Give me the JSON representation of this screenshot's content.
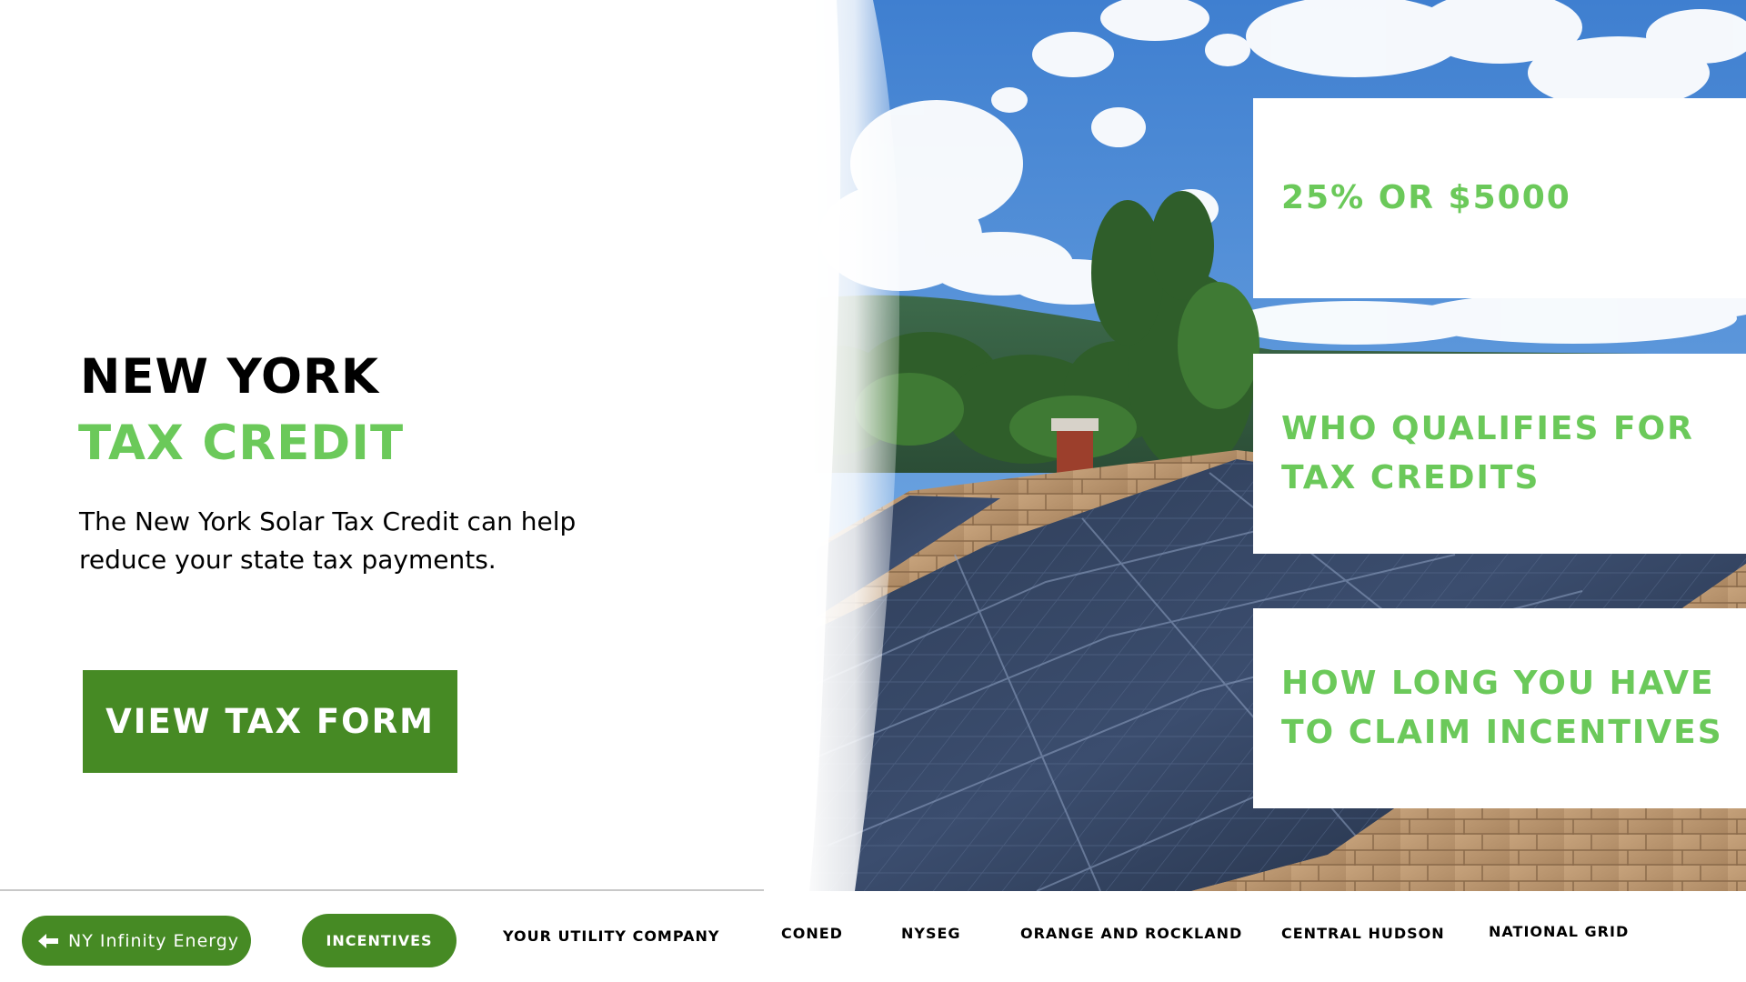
{
  "hero": {
    "title_line1": "NEW YORK",
    "title_line2": "TAX CREDIT",
    "description": "The New York Solar Tax Credit can help reduce your state tax payments.",
    "cta_label": "VIEW TAX FORM"
  },
  "info_cards": [
    {
      "label": "25% OR $5000"
    },
    {
      "label": "WHO QUALIFIES FOR TAX CREDITS"
    },
    {
      "label": "HOW LONG YOU HAVE TO CLAIM INCENTIVES"
    }
  ],
  "nav": {
    "back_label": "NY Infinity Energy",
    "back_icon": "arrow-left-icon",
    "active_label": "INCENTIVES",
    "links": [
      "YOUR UTILITY COMPANY",
      "CONED",
      "NYSEG",
      "ORANGE AND ROCKLAND",
      "CENTRAL HUDSON",
      "NATIONAL GRID"
    ]
  },
  "colors": {
    "brand_green": "#468a24",
    "accent_green": "#6bc95a",
    "text": "#000000",
    "background": "#ffffff"
  }
}
